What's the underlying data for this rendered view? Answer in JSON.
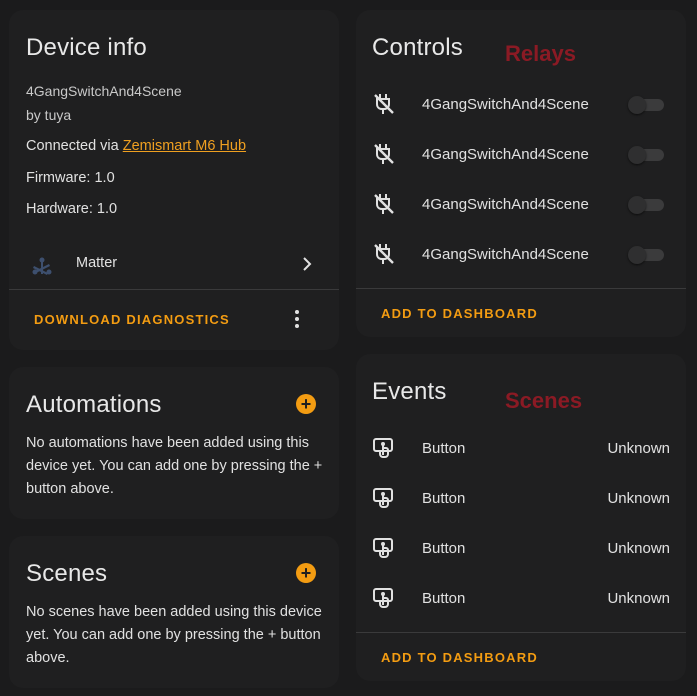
{
  "device_info": {
    "title": "Device info",
    "model": "4GangSwitchAnd4Scene",
    "by": "by tuya",
    "connected_prefix": "Connected via ",
    "connected_link": "Zemismart M6 Hub",
    "firmware": "Firmware: 1.0",
    "hardware": "Hardware: 1.0",
    "integration": "Matter",
    "download_label": "DOWNLOAD DIAGNOSTICS"
  },
  "automations": {
    "title": "Automations",
    "text": "No automations have been added using this device yet. You can add one by pressing the + button above."
  },
  "scenes": {
    "title": "Scenes",
    "text": "No scenes have been added using this device yet. You can add one by pressing the + button above."
  },
  "controls": {
    "title": "Controls",
    "overlay": "Relays",
    "items": [
      {
        "label": "4GangSwitchAnd4Scene",
        "state": "off"
      },
      {
        "label": "4GangSwitchAnd4Scene",
        "state": "off"
      },
      {
        "label": "4GangSwitchAnd4Scene",
        "state": "off"
      },
      {
        "label": "4GangSwitchAnd4Scene",
        "state": "off"
      }
    ],
    "add_label": "ADD TO DASHBOARD"
  },
  "events": {
    "title": "Events",
    "overlay": "Scenes",
    "items": [
      {
        "label": "Button",
        "value": "Unknown"
      },
      {
        "label": "Button",
        "value": "Unknown"
      },
      {
        "label": "Button",
        "value": "Unknown"
      },
      {
        "label": "Button",
        "value": "Unknown"
      }
    ],
    "add_label": "ADD TO DASHBOARD"
  },
  "colors": {
    "accent": "#f39c12",
    "overlay_text": "#8b1a24",
    "card_bg": "#1f1f20",
    "page_bg": "#1b1b1c"
  }
}
